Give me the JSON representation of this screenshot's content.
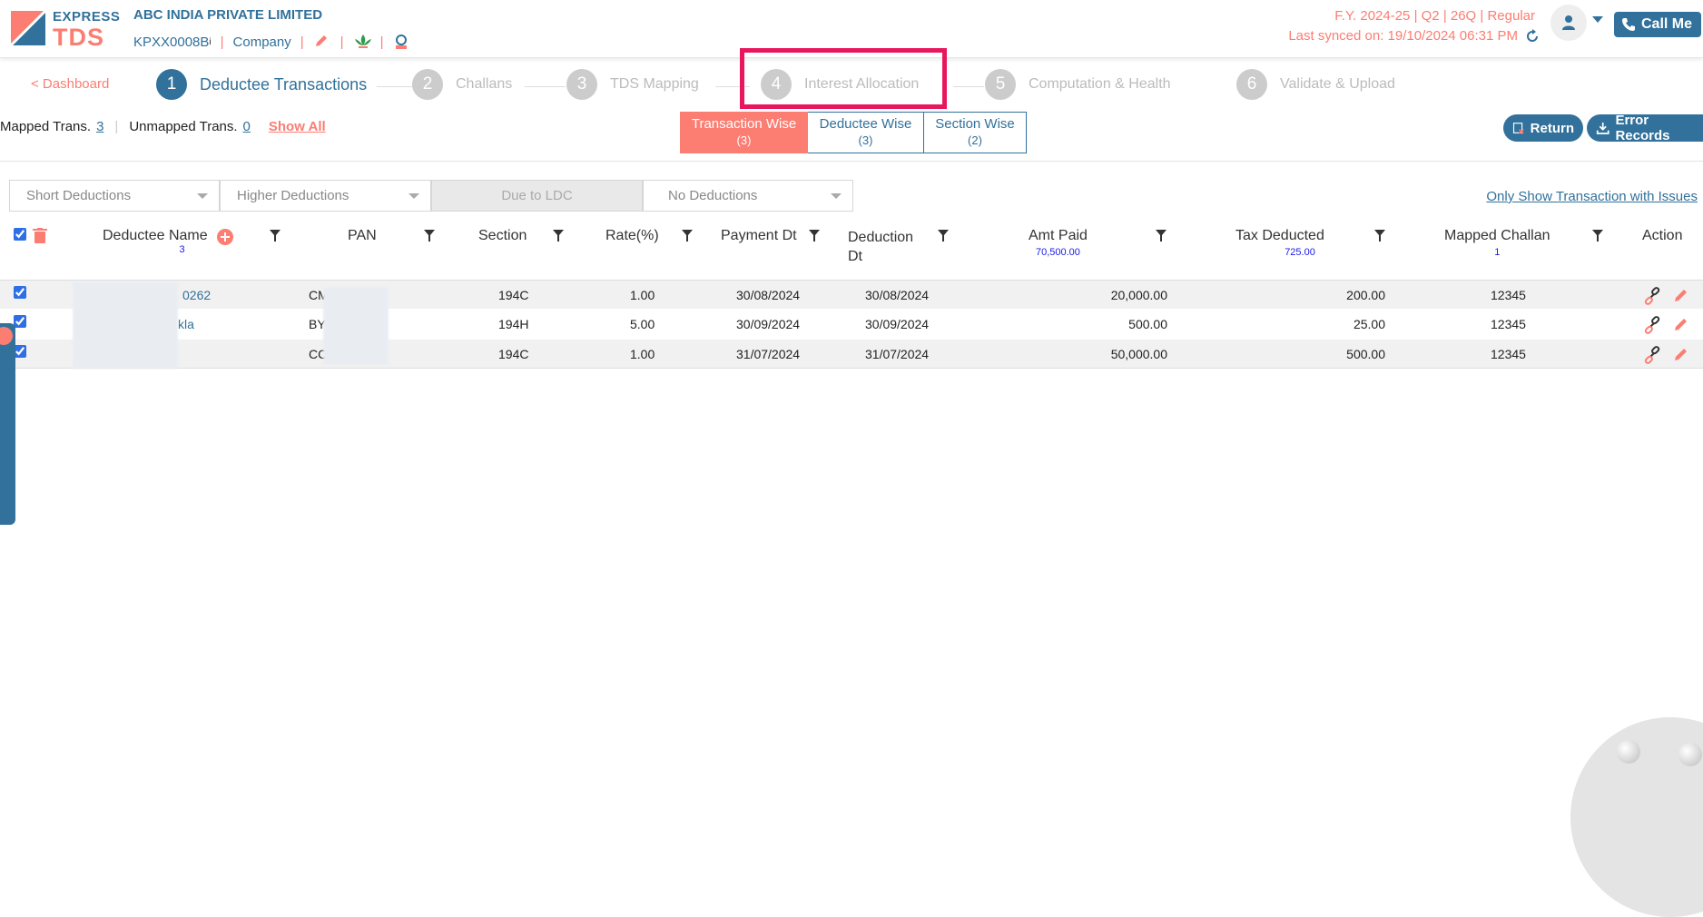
{
  "header": {
    "logo_line1": "EXPRESS",
    "logo_line2": "TDS",
    "company_name": "ABC INDIA PRIVATE LIMITED",
    "tan": "KPXX0008B",
    "info_mark": "i",
    "entity_type": "Company",
    "fy_info": "F.Y. 2024-25  | Q2  | 26Q | Regular",
    "last_synced": "Last synced on: 19/10/2024 06:31 PM",
    "call_me": "Call Me"
  },
  "stepper": {
    "dashboard": "< Dashboard",
    "steps": [
      {
        "num": "1",
        "label": "Deductee Transactions"
      },
      {
        "num": "2",
        "label": "Challans"
      },
      {
        "num": "3",
        "label": "TDS Mapping"
      },
      {
        "num": "4",
        "label": "Interest Allocation"
      },
      {
        "num": "5",
        "label": "Computation & Health"
      },
      {
        "num": "6",
        "label": "Validate & Upload"
      }
    ]
  },
  "summary": {
    "mapped_label": "Mapped Trans.",
    "mapped_count": "3",
    "unmapped_label": "Unmapped Trans.",
    "unmapped_count": "0",
    "show_all": "Show All"
  },
  "tabs": [
    {
      "label": "Transaction Wise",
      "count": "(3)"
    },
    {
      "label": "Deductee Wise",
      "count": "(3)"
    },
    {
      "label": "Section Wise",
      "count": "(2)"
    }
  ],
  "actions": {
    "return": "Return",
    "error_records": "Error Records"
  },
  "filters": {
    "short": "Short Deductions",
    "higher": "Higher Deductions",
    "ldc": "Due to LDC",
    "no": "No Deductions",
    "issues_link": "Only Show Transaction with Issues"
  },
  "table": {
    "headers": {
      "name": "Deductee Name",
      "name_total": "3",
      "pan": "PAN",
      "section": "Section",
      "rate": "Rate(%)",
      "payment_dt": "Payment Dt",
      "deduction_dt_1": "Deduction",
      "deduction_dt_2": "Dt",
      "amt_paid": "Amt Paid",
      "amt_total": "70,500.00",
      "tax_deducted": "Tax Deducted",
      "tax_total": "725.00",
      "mapped_challan": "Mapped Challan",
      "challan_total": "1",
      "action": "Action"
    },
    "rows": [
      {
        "name": "0262",
        "pan": "CM",
        "section": "194C",
        "rate": "1.00",
        "payment_dt": "30/08/2024",
        "deduction_dt": "30/08/2024",
        "amt_paid": "20,000.00",
        "tax": "200.00",
        "challan": "12345"
      },
      {
        "name": "kla",
        "pan": "BY",
        "section": "194H",
        "rate": "5.00",
        "payment_dt": "30/09/2024",
        "deduction_dt": "30/09/2024",
        "amt_paid": "500.00",
        "tax": "25.00",
        "challan": "12345"
      },
      {
        "name": "",
        "pan": "CC",
        "section": "194C",
        "rate": "1.00",
        "payment_dt": "31/07/2024",
        "deduction_dt": "31/07/2024",
        "amt_paid": "50,000.00",
        "tax": "500.00",
        "challan": "12345"
      }
    ]
  },
  "colors": {
    "primary": "#31719b",
    "accent": "#fc7d72",
    "highlight": "#e8175d"
  }
}
